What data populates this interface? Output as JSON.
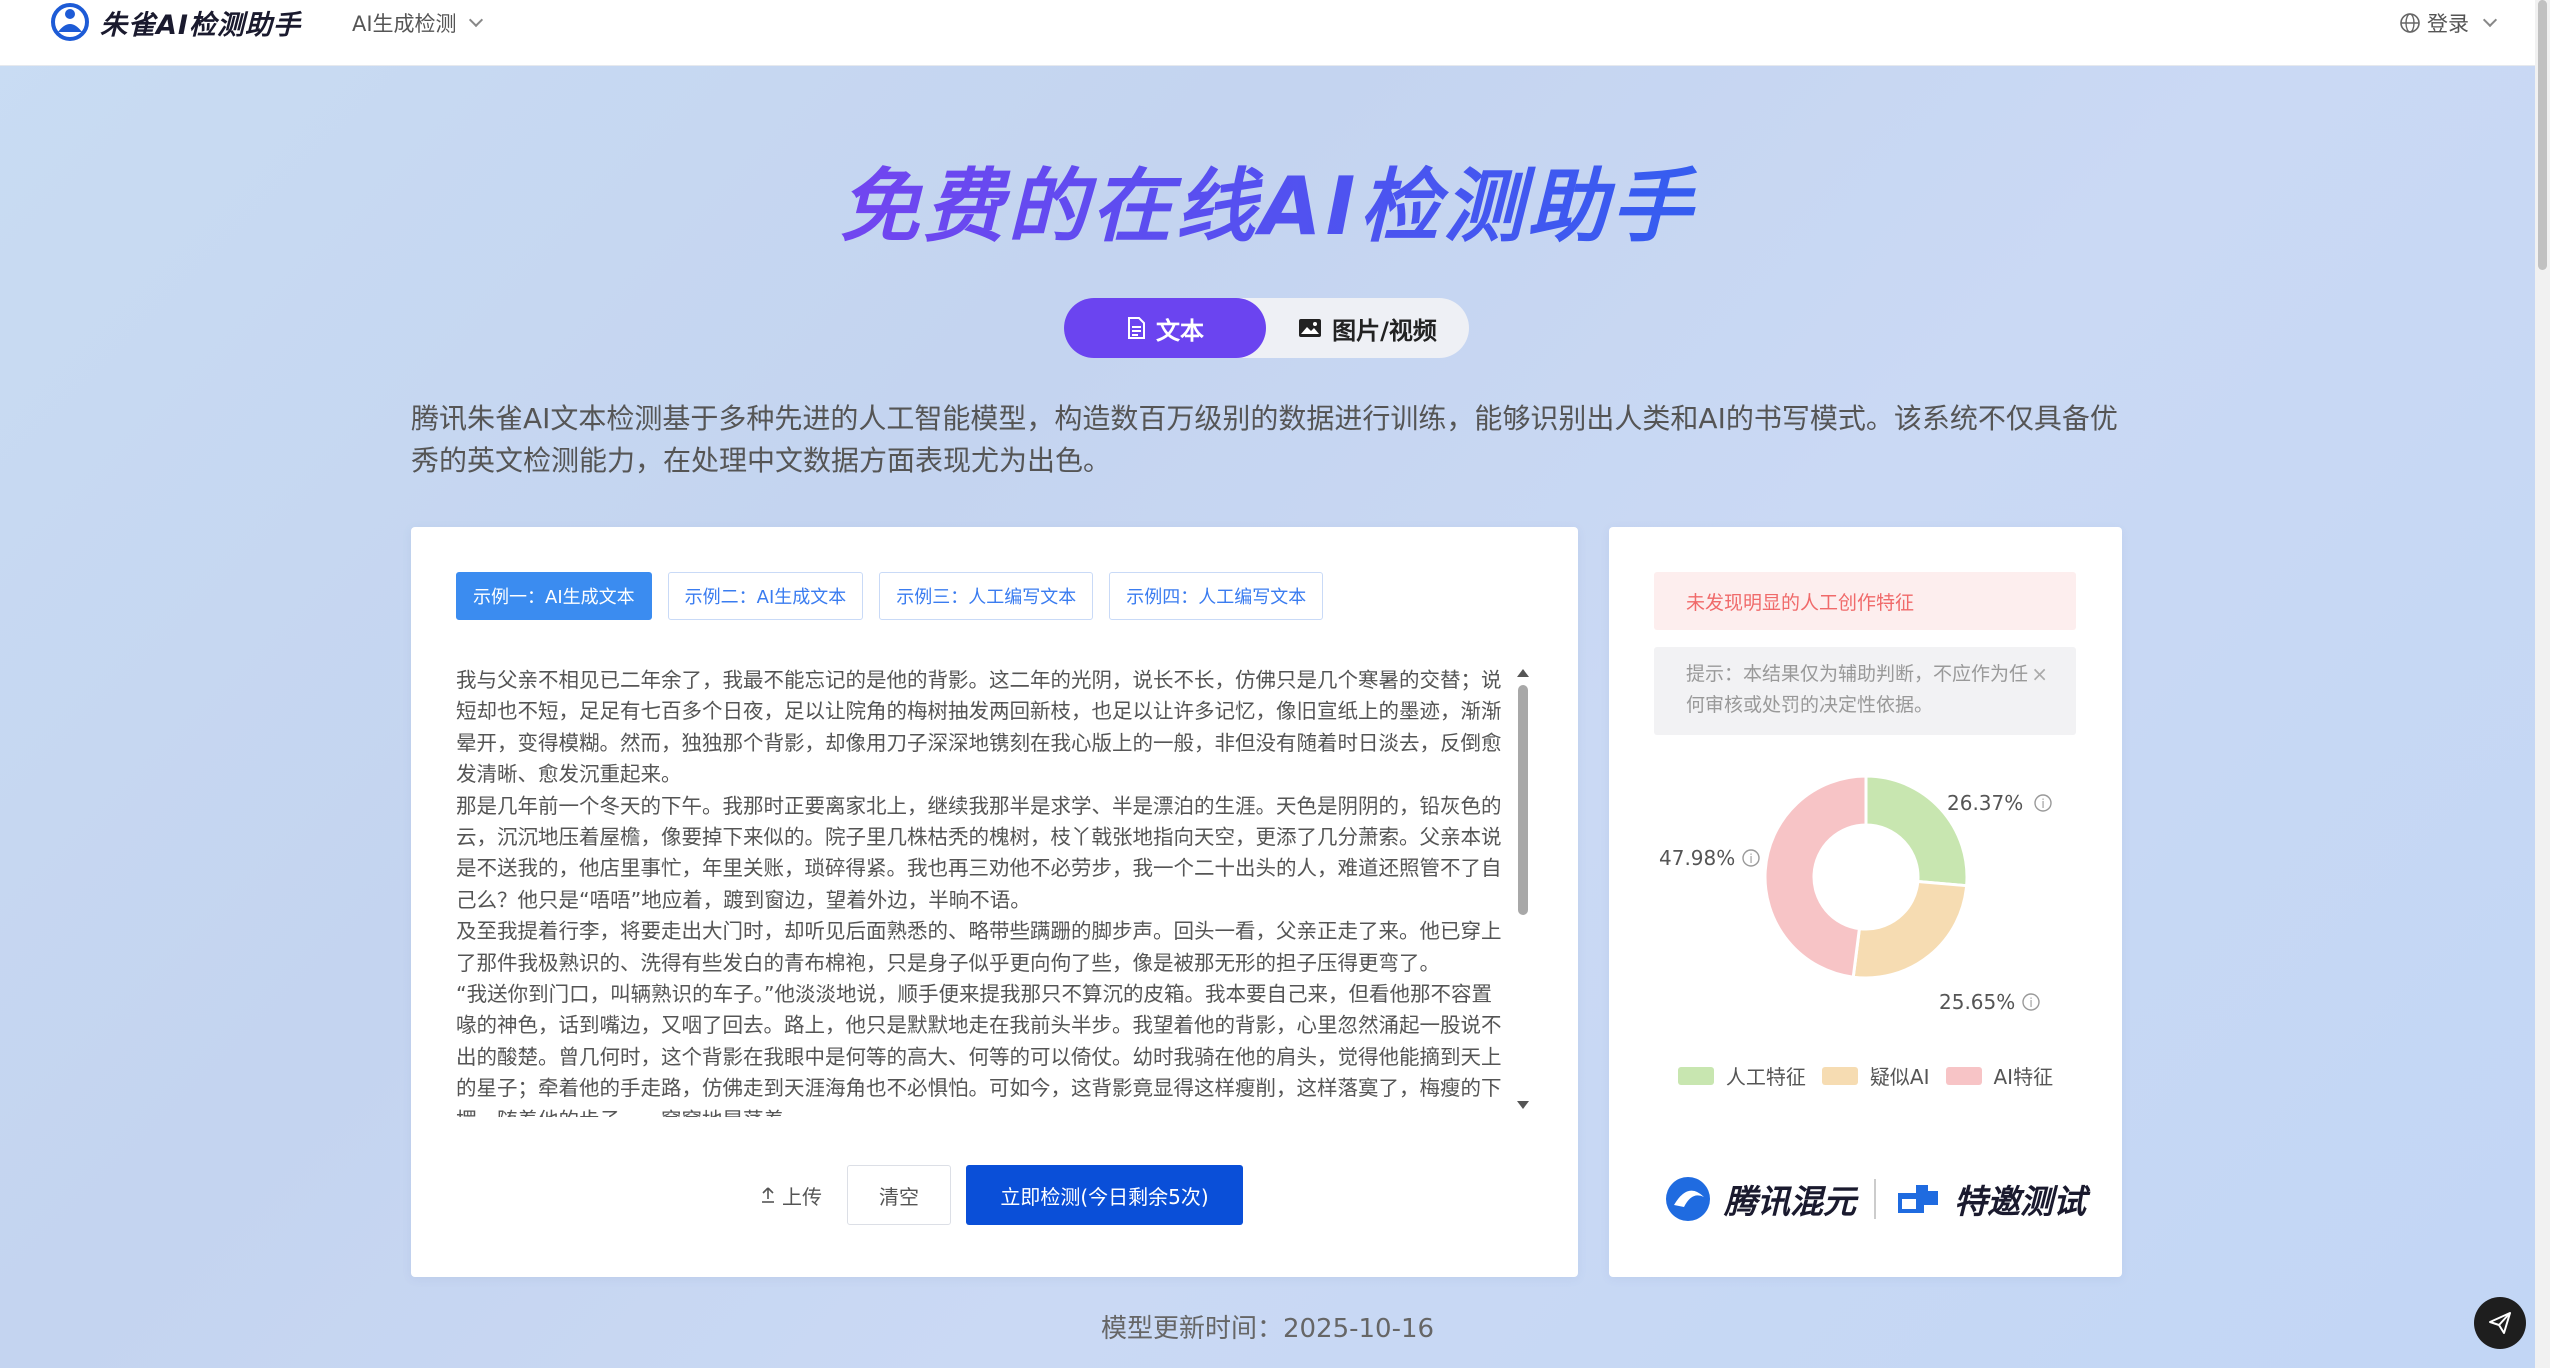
{
  "header": {
    "logo_text": "朱雀AI检测助手",
    "nav_dropdown": "AI生成检测",
    "login": "登录"
  },
  "hero": {
    "title": "免费的在线AI检测助手",
    "tabs": [
      {
        "label": "文本",
        "icon": "document-icon",
        "active": true
      },
      {
        "label": "图片/视频",
        "icon": "image-icon",
        "active": false
      }
    ],
    "description": "腾讯朱雀AI文本检测基于多种先进的人工智能模型，构造数百万级别的数据进行训练，能够识别出人类和AI的书写模式。该系统不仅具备优秀的英文检测能力，在处理中文数据方面表现尤为出色。"
  },
  "input_panel": {
    "examples": [
      {
        "label": "示例一：AI生成文本",
        "active": true
      },
      {
        "label": "示例二：AI生成文本",
        "active": false
      },
      {
        "label": "示例三：人工编写文本",
        "active": false
      },
      {
        "label": "示例四：人工编写文本",
        "active": false
      }
    ],
    "text_paragraphs": [
      "我与父亲不相见已二年余了，我最不能忘记的是他的背影。这二年的光阴，说长不长，仿佛只是几个寒暑的交替；说短却也不短，足足有七百多个日夜，足以让院角的梅树抽发两回新枝，也足以让许多记忆，像旧宣纸上的墨迹，渐渐晕开，变得模糊。然而，独独那个背影，却像用刀子深深地镌刻在我心版上的一般，非但没有随着时日淡去，反倒愈发清晰、愈发沉重起来。",
      "那是几年前一个冬天的下午。我那时正要离家北上，继续我那半是求学、半是漂泊的生涯。天色是阴阴的，铅灰色的云，沉沉地压着屋檐，像要掉下来似的。院子里几株枯秃的槐树，枝丫戟张地指向天空，更添了几分萧索。父亲本说是不送我的，他店里事忙，年里关账，琐碎得紧。我也再三劝他不必劳步，我一个二十出头的人，难道还照管不了自己么？他只是“唔唔”地应着，踱到窗边，望着外边，半晌不语。",
      "及至我提着行李，将要走出大门时，却听见后面熟悉的、略带些蹒跚的脚步声。回头一看，父亲正走了来。他已穿上了那件我极熟识的、洗得有些发白的青布棉袍，只是身子似乎更向佝了些，像是被那无形的担子压得更弯了。",
      "“我送你到门口，叫辆熟识的车子。”他淡淡地说，顺手便来提我那只不算沉的皮箱。我本要自己来，但看他那不容置喙的神色，话到嘴边，又咽了回去。路上，他只是默默地走在我前头半步。我望着他的背影，心里忽然涌起一股说不出的酸楚。曾几何时，这个背影在我眼中是何等的高大、何等的可以倚仗。幼时我骑在他的肩头，觉得他能摘到天上的星子；牵着他的手走路，仿佛走到天涯海角也不必惧怕。可如今，这背影竟显得这样瘦削，这样落寞了，梅瘦的下摆，随着他的步子，一窝窝地晃荡着。"
    ],
    "upload_label": "上传",
    "clear_label": "清空",
    "detect_label": "立即检测(今日剩余5次)"
  },
  "result_panel": {
    "alert": "未发现明显的人工创作特征",
    "tip": "提示：本结果仅为辅助判断，不应作为任何审核或处罚的决定性依据。",
    "tip_close": "×",
    "chart_labels": {
      "human": "26.37%",
      "suspect": "25.65%",
      "ai": "47.98%"
    },
    "legend": [
      {
        "label": "人工特征",
        "color": "#c8e6b0"
      },
      {
        "label": "疑似AI",
        "color": "#f6dcb2"
      },
      {
        "label": "AI特征",
        "color": "#f7c4c6"
      }
    ],
    "brand_left": "腾讯混元",
    "brand_right": "特邀测试"
  },
  "chart_data": {
    "type": "pie",
    "categories": [
      "人工特征",
      "疑似AI",
      "AI特征"
    ],
    "values": [
      26.37,
      25.65,
      47.98
    ],
    "colors": [
      "#c8e6b0",
      "#f6dcb2",
      "#f7c4c6"
    ]
  },
  "footer": {
    "update_time": "模型更新时间：2025-10-16"
  }
}
